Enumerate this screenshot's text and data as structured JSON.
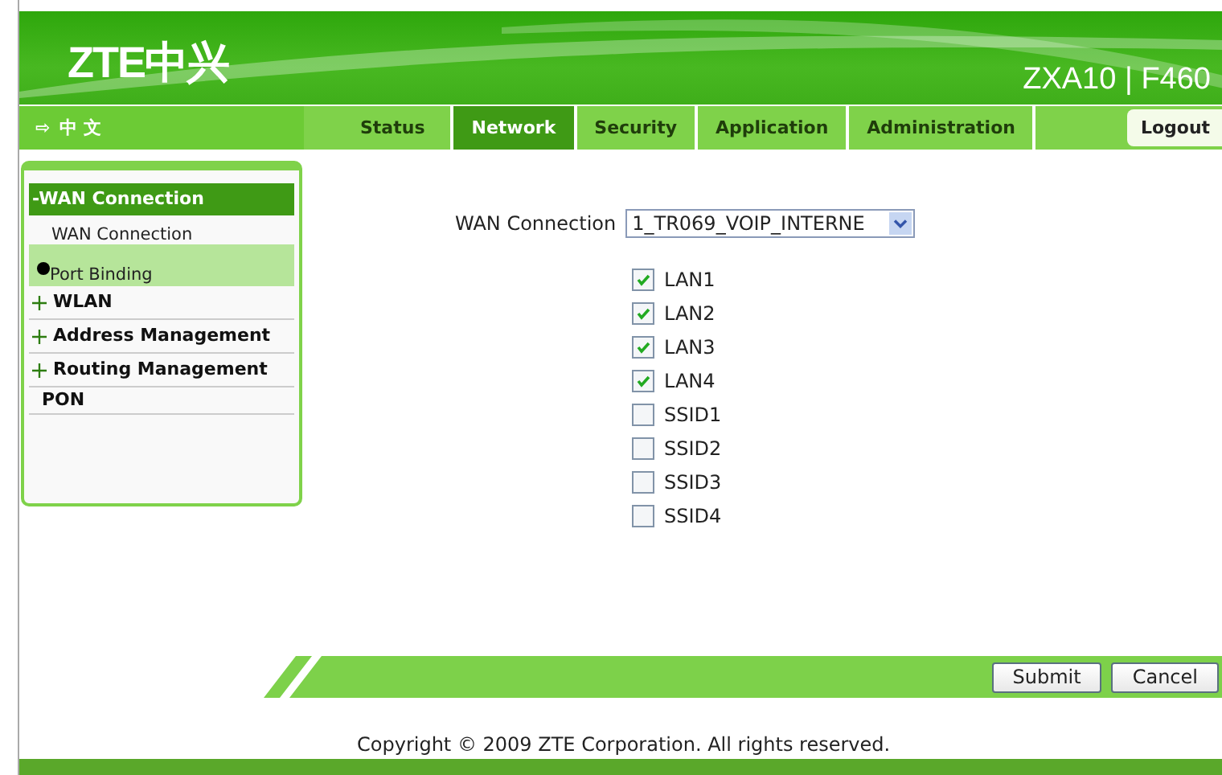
{
  "header": {
    "logo": "ZTE中兴",
    "model": "ZXA10 | F460"
  },
  "language": {
    "arrow": "⇨",
    "label": "中 文"
  },
  "tabs": [
    {
      "label": "Status",
      "selected": false
    },
    {
      "label": "Network",
      "selected": true
    },
    {
      "label": "Security",
      "selected": false
    },
    {
      "label": "Application",
      "selected": false
    },
    {
      "label": "Administration",
      "selected": false
    }
  ],
  "logout": "Logout",
  "sidebar": {
    "items": [
      {
        "kind": "group",
        "label": "-WAN Connection",
        "expanded": true,
        "children": [
          {
            "label": "WAN Connection",
            "selected": false
          },
          {
            "label": "Port Binding",
            "selected": true
          }
        ]
      },
      {
        "kind": "group",
        "label": "WLAN",
        "expanded": false
      },
      {
        "kind": "group",
        "label": "Address Management",
        "expanded": false
      },
      {
        "kind": "group",
        "label": "Routing Management",
        "expanded": false
      },
      {
        "kind": "leaf",
        "label": "PON"
      }
    ]
  },
  "form": {
    "select_label": "WAN Connection",
    "select_value": "1_TR069_VOIP_INTERNE",
    "ports": [
      {
        "label": "LAN1",
        "checked": true
      },
      {
        "label": "LAN2",
        "checked": true
      },
      {
        "label": "LAN3",
        "checked": true
      },
      {
        "label": "LAN4",
        "checked": true
      },
      {
        "label": "SSID1",
        "checked": false
      },
      {
        "label": "SSID2",
        "checked": false
      },
      {
        "label": "SSID3",
        "checked": false
      },
      {
        "label": "SSID4",
        "checked": false
      }
    ]
  },
  "buttons": [
    "Submit",
    "Cancel"
  ],
  "copyright": "Copyright © 2009 ZTE Corporation. All rights reserved."
}
